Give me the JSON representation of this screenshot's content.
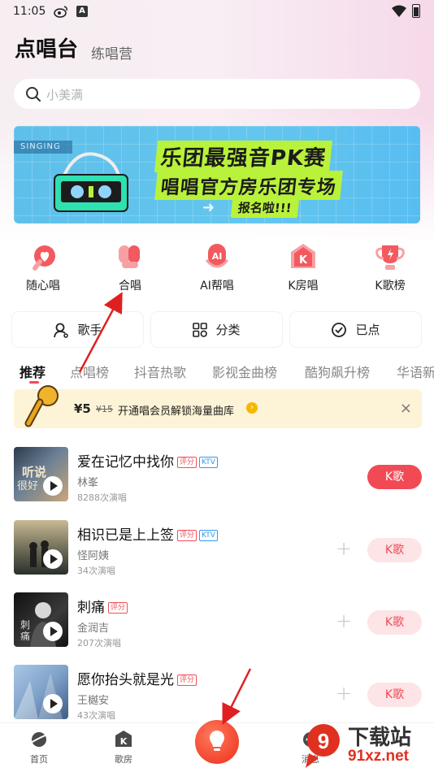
{
  "status_bar": {
    "time": "11:05",
    "a_label": "A"
  },
  "header": {
    "title": "点唱台",
    "subtitle": "练唱营"
  },
  "search": {
    "placeholder": "小美满"
  },
  "banner": {
    "tag": "SINGING",
    "title": "乐团最强音PK赛",
    "subtitle": "唱唱官方房乐团专场",
    "cta": "报名啦!!!"
  },
  "quick_entries": [
    {
      "label": "随心唱",
      "icon": "heart-icon",
      "color": "#f25a60"
    },
    {
      "label": "合唱",
      "icon": "duet-mic-icon",
      "color": "#f25a60"
    },
    {
      "label": "AI帮唱",
      "icon": "ai-mic-icon",
      "color": "#f25a60"
    },
    {
      "label": "K房唱",
      "icon": "k-room-icon",
      "color": "#f25a60"
    },
    {
      "label": "K歌榜",
      "icon": "trophy-icon",
      "color": "#f25a60"
    }
  ],
  "categories": [
    {
      "label": "歌手",
      "icon": "singer-icon"
    },
    {
      "label": "分类",
      "icon": "grid-icon"
    },
    {
      "label": "已点",
      "icon": "check-circle-icon"
    }
  ],
  "tabs": [
    "推荐",
    "点唱榜",
    "抖音热歌",
    "影视金曲榜",
    "酷狗飙升榜",
    "华语新"
  ],
  "promo": {
    "price": "¥5",
    "old_price": "¥15",
    "text": "开通唱会员解锁海量曲库",
    "close": "×"
  },
  "songs": [
    {
      "title": "爱在记忆中找你",
      "tags": [
        "评分",
        "KTV"
      ],
      "artist": "林峯",
      "count": "8288次演唱",
      "button": "K歌",
      "primary": true
    },
    {
      "title": "相识已是上上签",
      "tags": [
        "评分",
        "KTV"
      ],
      "artist": "怪阿姨",
      "count": "34次演唱",
      "button": "K歌",
      "primary": false
    },
    {
      "title": "刺痛",
      "tags": [
        "评分"
      ],
      "artist": "金润吉",
      "count": "207次演唱",
      "button": "K歌",
      "primary": false
    },
    {
      "title": "愿你抬头就是光",
      "tags": [
        "评分"
      ],
      "artist": "王樾安",
      "count": "43次演唱",
      "button": "K歌",
      "primary": false
    }
  ],
  "bottom_nav": [
    {
      "label": "首页",
      "icon": "planet-icon"
    },
    {
      "label": "歌房",
      "icon": "k-room-nav-icon"
    },
    {
      "label": "消息",
      "icon": "message-icon"
    }
  ],
  "watermark": {
    "line1": "下载站",
    "line2": "91xz.net",
    "badge": "9"
  },
  "colors": {
    "accent": "#f24a55",
    "banner_green": "#b9f23a",
    "banner_blue": "#5ec0ea"
  }
}
